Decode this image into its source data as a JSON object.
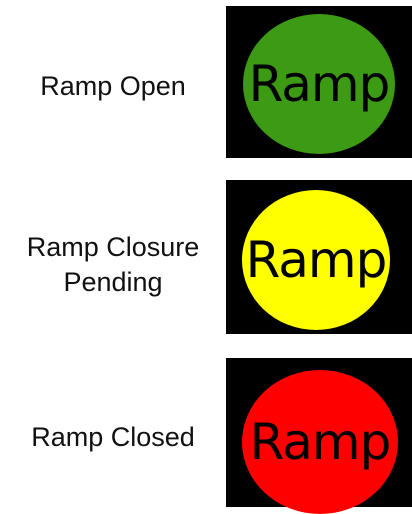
{
  "signals": [
    {
      "label": "Ramp Open",
      "lamp_text": "Ramp",
      "color": "#3c9a15"
    },
    {
      "label": "Ramp Closure Pending",
      "lamp_text": "Ramp",
      "color": "#ffff00"
    },
    {
      "label": "Ramp Closed",
      "lamp_text": "Ramp",
      "color": "#ff0000"
    }
  ]
}
